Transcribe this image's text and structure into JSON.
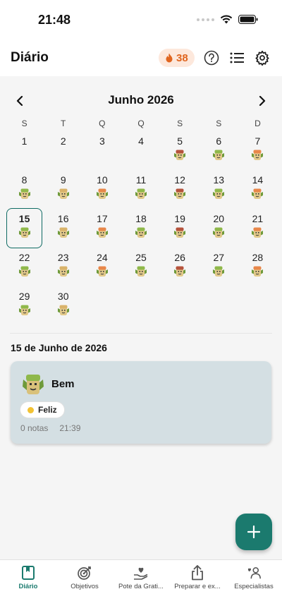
{
  "status_bar": {
    "time": "21:48"
  },
  "header": {
    "title": "Diário",
    "streak_count": "38",
    "help_icon": "help-circle-icon",
    "list_icon": "list-icon",
    "settings_icon": "gear-icon"
  },
  "calendar": {
    "month_label": "Junho 2026",
    "weekdays": [
      "S",
      "T",
      "Q",
      "Q",
      "S",
      "S",
      "D"
    ],
    "leading_blanks": 4,
    "selected_day": "15",
    "days": [
      {
        "n": "1",
        "mood": ""
      },
      {
        "n": "2",
        "mood": ""
      },
      {
        "n": "3",
        "mood": ""
      },
      {
        "n": "4",
        "mood": ""
      },
      {
        "n": "5",
        "mood": "dark"
      },
      {
        "n": "6",
        "mood": "green"
      },
      {
        "n": "7",
        "mood": "orange"
      },
      {
        "n": "8",
        "mood": "green"
      },
      {
        "n": "9",
        "mood": "tan"
      },
      {
        "n": "10",
        "mood": "orange"
      },
      {
        "n": "11",
        "mood": "green"
      },
      {
        "n": "12",
        "mood": "dark"
      },
      {
        "n": "13",
        "mood": "green"
      },
      {
        "n": "14",
        "mood": "orange"
      },
      {
        "n": "15",
        "mood": "green"
      },
      {
        "n": "16",
        "mood": "tan"
      },
      {
        "n": "17",
        "mood": "orange"
      },
      {
        "n": "18",
        "mood": "green"
      },
      {
        "n": "19",
        "mood": "dark"
      },
      {
        "n": "20",
        "mood": "green"
      },
      {
        "n": "21",
        "mood": "orange"
      },
      {
        "n": "22",
        "mood": "green"
      },
      {
        "n": "23",
        "mood": "tan"
      },
      {
        "n": "24",
        "mood": "orange"
      },
      {
        "n": "25",
        "mood": "green"
      },
      {
        "n": "26",
        "mood": "dark"
      },
      {
        "n": "27",
        "mood": "green"
      },
      {
        "n": "28",
        "mood": "orange"
      },
      {
        "n": "29",
        "mood": "green"
      },
      {
        "n": "30",
        "mood": "tan"
      }
    ]
  },
  "mood_colors": {
    "green": "#8fb84a",
    "orange": "#e8874a",
    "tan": "#d9b36a",
    "dark": "#b5533c"
  },
  "entry": {
    "date_heading": "15 de Junho de 2026",
    "mood_label": "Bem",
    "chip_label": "Feliz",
    "chip_color": "#f2c233",
    "notes": "0 notas",
    "time": "21:39",
    "card_color": "#d4dfe3"
  },
  "fab": {
    "icon": "plus-icon"
  },
  "bottom_nav": {
    "items": [
      {
        "label": "Diário",
        "icon": "book-icon",
        "active": true
      },
      {
        "label": "Objetivos",
        "icon": "target-icon",
        "active": false
      },
      {
        "label": "Pote da Grati...",
        "icon": "heart-hand-icon",
        "active": false
      },
      {
        "label": "Preparar e ex...",
        "icon": "share-icon",
        "active": false
      },
      {
        "label": "Especialistas",
        "icon": "people-icon",
        "active": false
      }
    ]
  },
  "accent_color": "#1b7a6e"
}
